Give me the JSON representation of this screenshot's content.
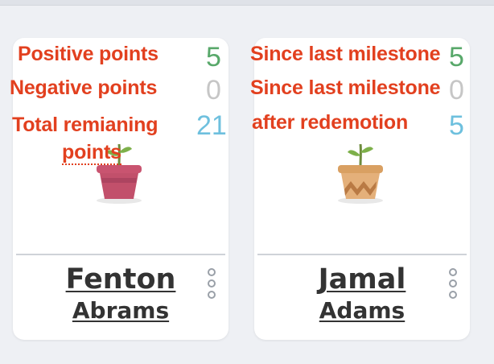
{
  "cards": [
    {
      "labels": {
        "positive": "Positive points",
        "negative": "Negative points",
        "total_line1": "Total remianing",
        "total_line2": "points"
      },
      "values": {
        "positive": "5",
        "negative": "0",
        "total": "21"
      },
      "first_name": "Fenton",
      "last_name": "Abrams",
      "pot_icon": "plant-pot-pink-icon",
      "menu_icon": "vertical-dots-icon"
    },
    {
      "labels": {
        "positive": "Since last milestone",
        "negative": "Since last milestone",
        "total_line1": "after redemotion"
      },
      "values": {
        "positive": "5",
        "negative": "0",
        "total": "5"
      },
      "first_name": "Jamal",
      "last_name": "Adams",
      "pot_icon": "plant-pot-terracotta-icon",
      "menu_icon": "vertical-dots-icon"
    }
  ],
  "colors": {
    "annotation": "#e2401f",
    "positive": "#58a86a",
    "negative": "#c6c6c6",
    "total": "#6ec0de"
  }
}
